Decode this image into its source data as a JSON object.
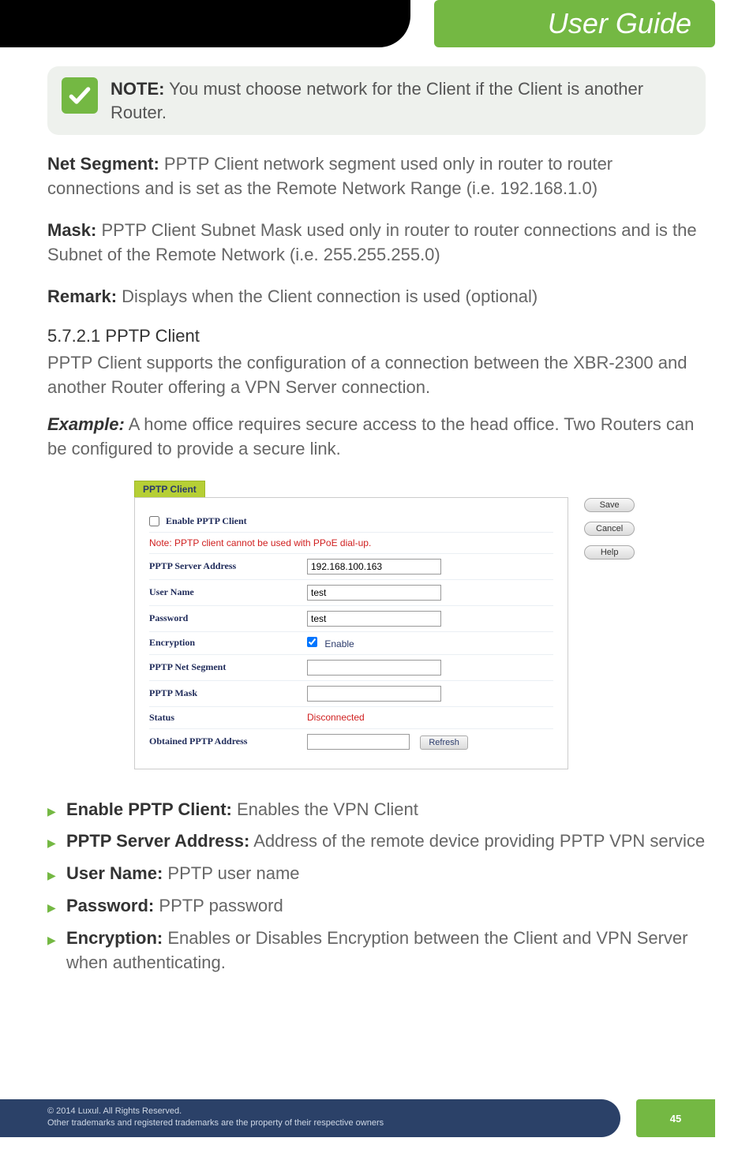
{
  "header": {
    "title": "User Guide"
  },
  "note": {
    "label": "NOTE:",
    "text": "You must choose network for the Client if the Client is another Router."
  },
  "paras": {
    "net_segment_label": "Net Segment:",
    "net_segment_text": "PPTP Client network segment used only in router to router connections and is set as the Remote Network Range (i.e. 192.168.1.0)",
    "mask_label": "Mask:",
    "mask_text": "PPTP Client Subnet Mask used only in router to router connections and is the Subnet of the Remote Network (i.e. 255.255.255.0)",
    "remark_label": "Remark:",
    "remark_text": "Displays when the Client connection is used (optional)"
  },
  "section": {
    "heading": "5.7.2.1 PPTP Client",
    "desc": "PPTP Client supports the configuration of a connection between the XBR-2300 and another Router offering a VPN Server connection.",
    "example_label": "Example:",
    "example_text": "A home office requires secure access to the head office. Two Routers can be configured to provide a secure link."
  },
  "panel": {
    "tab": "PPTP Client",
    "enable_label": "Enable PPTP Client",
    "note_red": "Note: PPTP client cannot be used with PPoE dial-up.",
    "rows": {
      "server_label": "PPTP Server Address",
      "server_value": "192.168.100.163",
      "user_label": "User Name",
      "user_value": "test",
      "pass_label": "Password",
      "pass_value": "test",
      "enc_label": "Encryption",
      "enc_value": "Enable",
      "netseg_label": "PPTP Net Segment",
      "netseg_value": "",
      "mask_label": "PPTP Mask",
      "mask_value": "",
      "status_label": "Status",
      "status_value": "Disconnected",
      "obtained_label": "Obtained PPTP Address",
      "obtained_value": "",
      "refresh": "Refresh"
    },
    "buttons": {
      "save": "Save",
      "cancel": "Cancel",
      "help": "Help"
    }
  },
  "bullets": [
    {
      "label": "Enable PPTP Client:",
      "text": "Enables the VPN Client"
    },
    {
      "label": "PPTP Server Address:",
      "text": "Address of the remote device providing PPTP VPN service"
    },
    {
      "label": "User Name:",
      "text": "PPTP user name"
    },
    {
      "label": "Password:",
      "text": "PPTP password"
    },
    {
      "label": "Encryption:",
      "text": "Enables or Disables Encryption between the Client and VPN Server when authenticating."
    }
  ],
  "footer": {
    "line1": "© 2014  Luxul. All Rights Reserved.",
    "line2": "Other trademarks and registered trademarks are the property of their respective owners",
    "page": "45"
  }
}
